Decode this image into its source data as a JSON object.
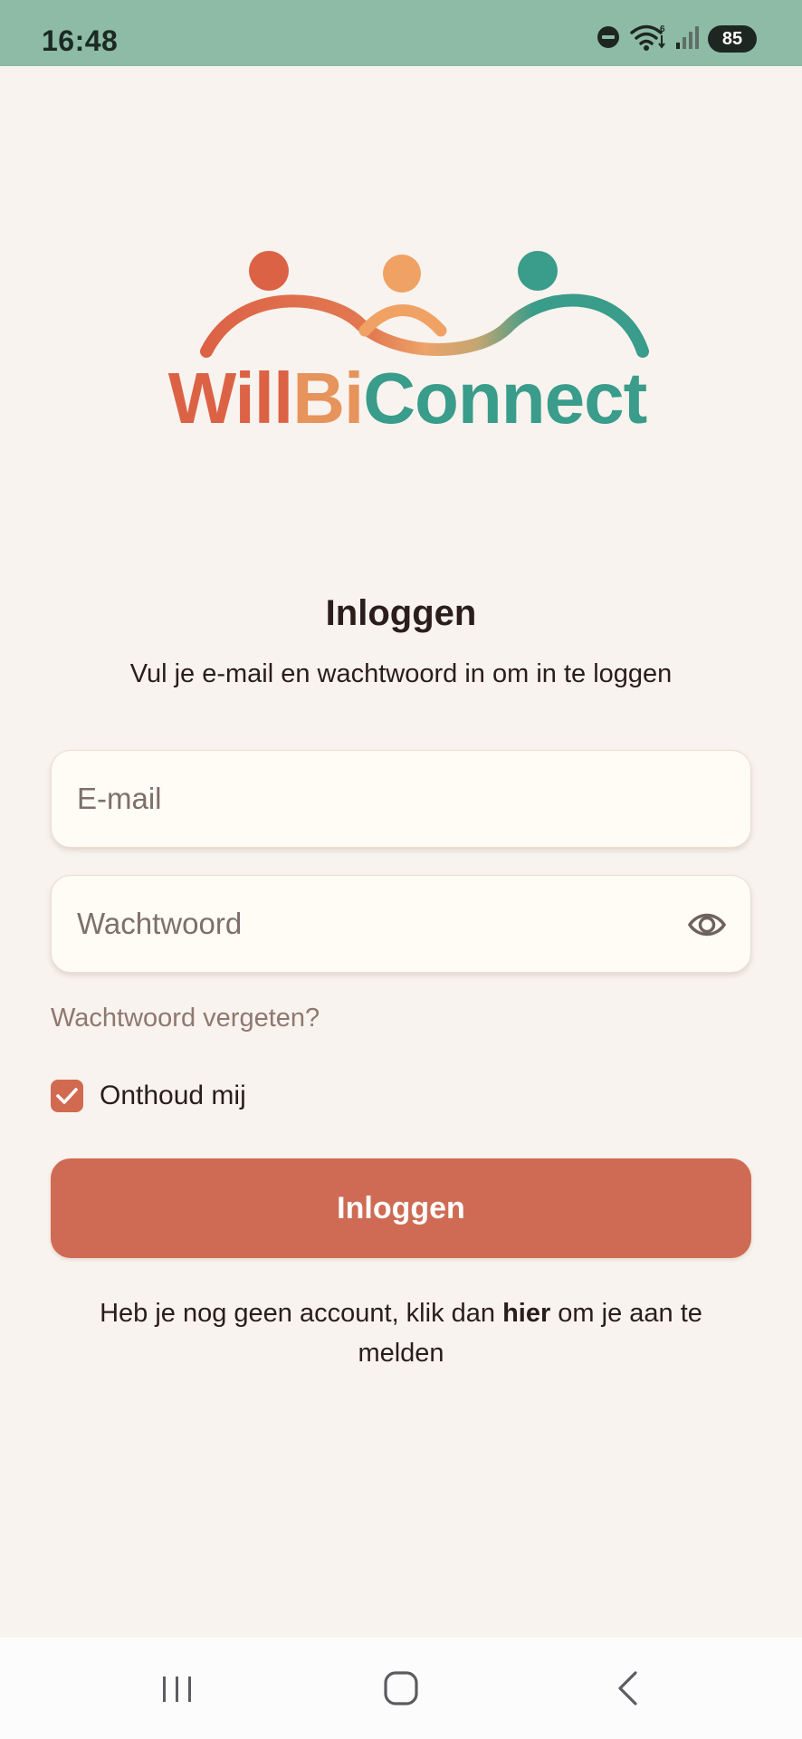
{
  "status_bar": {
    "time": "16:48",
    "battery": "85",
    "icons": [
      "do-not-disturb-icon",
      "wifi-icon",
      "signal-icon",
      "battery-icon"
    ]
  },
  "logo": {
    "part1": "Will",
    "part2": "Bi",
    "part3": "Connect",
    "colors": {
      "red": "#dc6246",
      "orange": "#e7935c",
      "teal": "#3a9c8a"
    }
  },
  "login": {
    "title": "Inloggen",
    "subtitle": "Vul je e-mail en wachtwoord in om in te loggen",
    "email_placeholder": "E-mail",
    "password_placeholder": "Wachtwoord",
    "forgot_password": "Wachtwoord vergeten?",
    "remember_me": "Onthoud mij",
    "remember_me_checked": true,
    "button_label": "Inloggen"
  },
  "signup": {
    "before": "Heb je nog geen account, klik dan ",
    "link": "hier",
    "after": " om je aan te melden"
  },
  "nav": {
    "icons": [
      "recents-icon",
      "home-icon",
      "back-icon"
    ]
  },
  "colors": {
    "status_bar": "#8dbba5",
    "background": "#f8f3ee",
    "accent": "#cf6b54"
  }
}
